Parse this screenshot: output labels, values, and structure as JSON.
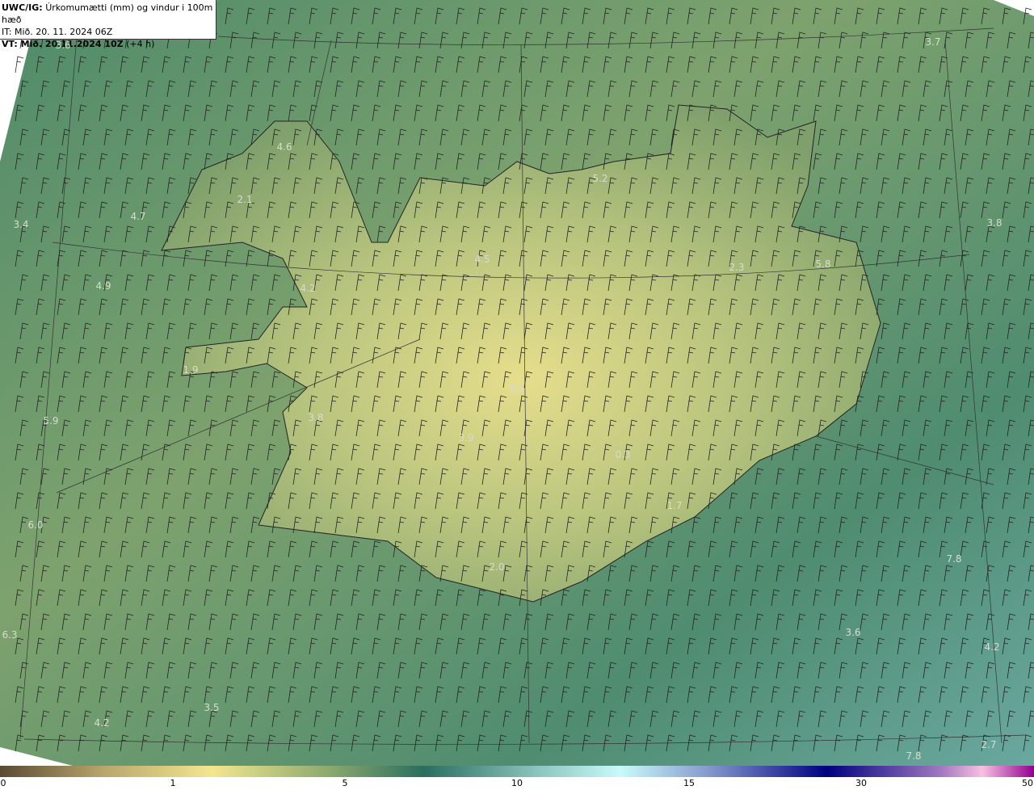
{
  "title": {
    "model": "UWC/IG:",
    "description": "Úrkomumætti (mm) og vindur i 100m hæð",
    "it": "IT: Mið. 20. 11. 2024 06Z",
    "vt_bold": "VT: Mið. 20.11.2024 10Z",
    "vt_offset": "(+4 h)"
  },
  "colorbar": {
    "ticks": [
      "0",
      "1",
      "5",
      "10",
      "15",
      "30",
      "50"
    ]
  },
  "value_labels": [
    "3.6",
    "3.7",
    "4.6",
    "5.2",
    "3.4",
    "4.7",
    "3.8",
    "4.5",
    "5.8",
    "4.9",
    "4.2",
    "5.9",
    "3.8",
    "3.9",
    "6.0",
    "7.8",
    "6.3",
    "3.6",
    "4.2",
    "3.5",
    "4.2",
    "7.8",
    "2.7",
    "2.1",
    "2.3",
    "1.9",
    "0.8",
    "0.3",
    "1.7",
    "2.0"
  ]
}
